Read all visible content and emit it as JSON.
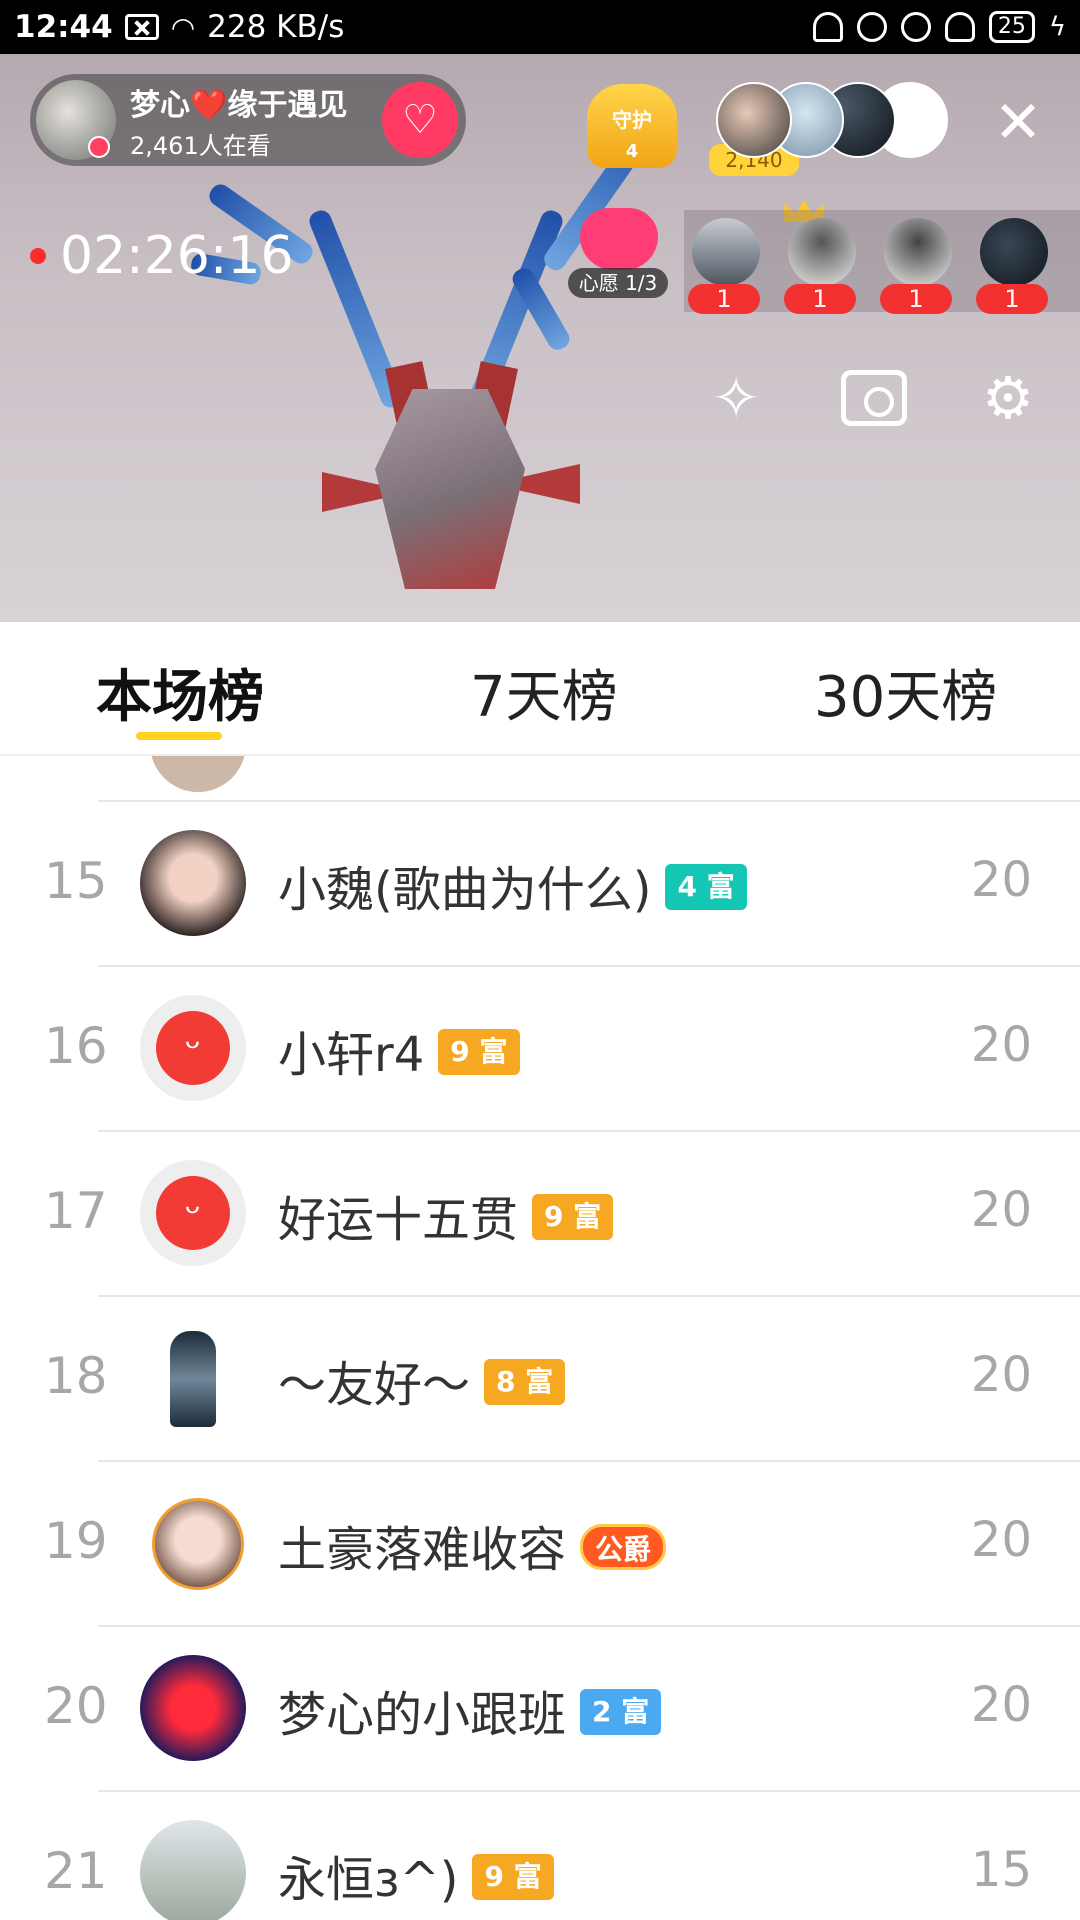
{
  "status_bar": {
    "time": "12:44",
    "speed": "228 KB/s",
    "battery": "25"
  },
  "host": {
    "name": "梦心❤️缘于遇见",
    "watching": "2,461人在看",
    "follow_icon": "heart-plus-icon"
  },
  "guard": {
    "label": "守护",
    "count": "4"
  },
  "fans": {
    "count": "2,140"
  },
  "timer": "02:26:16",
  "wish": {
    "label": "心愿 1/3"
  },
  "gift_users": [
    "1",
    "1",
    "1",
    "1"
  ],
  "tabs": [
    {
      "label": "本场榜",
      "active": true
    },
    {
      "label": "7天榜",
      "active": false
    },
    {
      "label": "30天榜",
      "active": false
    }
  ],
  "rows": [
    {
      "rank": "15",
      "name": "小魏(歌曲为什么)",
      "badge": "4 富",
      "badge_color": "#13c7b4",
      "score": "20"
    },
    {
      "rank": "16",
      "name": "小轩r4",
      "badge": "9 富",
      "badge_color": "#f7a823",
      "score": "20"
    },
    {
      "rank": "17",
      "name": "好运十五贯",
      "badge": "9 富",
      "badge_color": "#f7a823",
      "score": "20"
    },
    {
      "rank": "18",
      "name": "～友好～",
      "badge": "8 富",
      "badge_color": "#f7a823",
      "score": "20"
    },
    {
      "rank": "19",
      "name": "土豪落难收容",
      "badge": "公爵",
      "badge_color": "#ff5a1f",
      "score": "20"
    },
    {
      "rank": "20",
      "name": "梦心的小跟班",
      "badge": "2 富",
      "badge_color": "#4aa9f0",
      "score": "20"
    },
    {
      "rank": "21",
      "name": "永恒з^)",
      "badge": "9 富",
      "badge_color": "#f7a823",
      "score": "15"
    }
  ]
}
